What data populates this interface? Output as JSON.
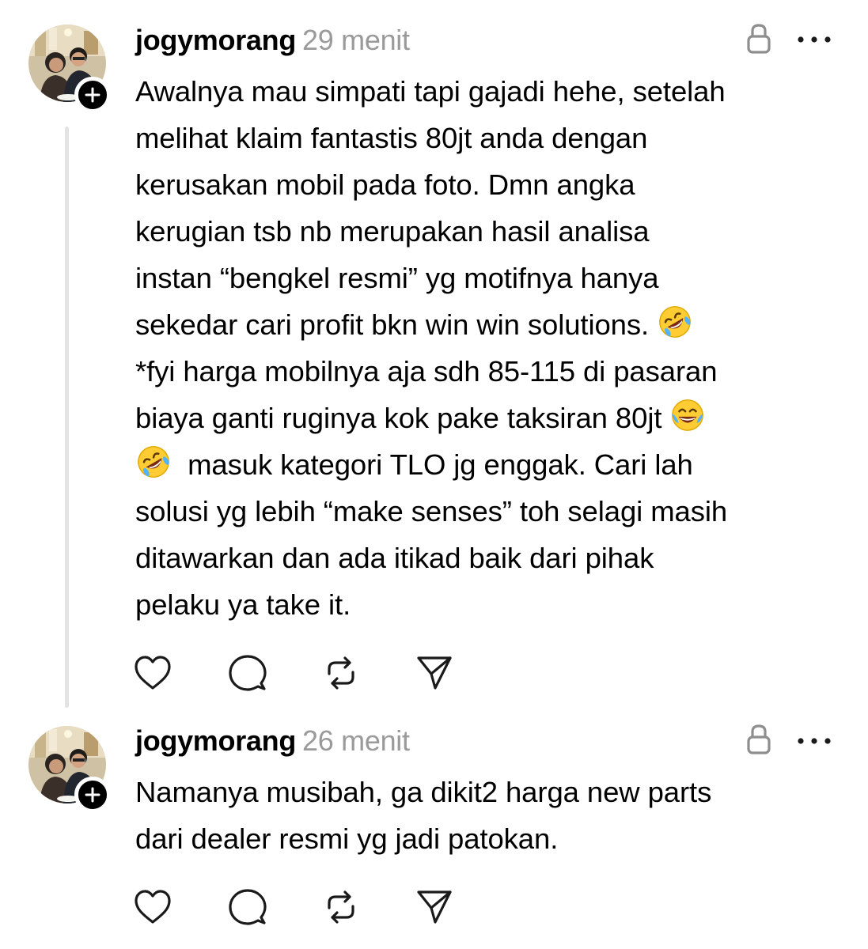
{
  "posts": [
    {
      "username": "jogymorang",
      "timestamp": "29 menit",
      "avatar_icon": "profile-photo",
      "follow_icon": "plus-icon",
      "lock_icon": "lock-icon",
      "more_icon": "more-horizontal-icon",
      "body_lines": [
        "Awalnya mau simpati tapi gajadi hehe, setelah",
        "melihat klaim fantastis 80jt anda dengan",
        "kerusakan mobil pada foto. Dmn angka",
        "kerugian tsb nb merupakan hasil analisa",
        "instan “bengkel resmi” yg motifnya hanya",
        "sekedar cari profit bkn win win solutions.",
        "*fyi harga mobilnya aja sdh 85-115 di pasaran",
        "biaya ganti ruginya kok pake taksiran 80jt",
        "masuk kategori TLO jg enggak. Cari lah",
        "solusi yg lebih “make senses” toh selagi masih",
        "ditawarkan dan ada itikad baik dari pihak",
        "pelaku ya take it."
      ],
      "emojis": [
        "rolling-on-floor-laughing-emoji",
        "face-with-tears-of-joy-emoji",
        "rolling-on-floor-laughing-emoji"
      ],
      "actions": [
        "heart-icon",
        "comment-icon",
        "repost-icon",
        "share-icon"
      ]
    },
    {
      "username": "jogymorang",
      "timestamp": "26 menit",
      "avatar_icon": "profile-photo",
      "follow_icon": "plus-icon",
      "lock_icon": "lock-icon",
      "more_icon": "more-horizontal-icon",
      "body_lines": [
        "Namanya musibah, ga dikit2 harga new parts",
        "dari dealer resmi yg jadi patokan."
      ],
      "emojis": [],
      "actions": [
        "heart-icon",
        "comment-icon",
        "repost-icon",
        "share-icon"
      ]
    }
  ],
  "colors": {
    "text": "#000000",
    "timestamp": "#9a9a9a",
    "icon": "#1a1a1a",
    "muted_icon": "#8e8e8e",
    "thread_line": "#e3e3e3",
    "emoji_face": "#ffcc33"
  }
}
